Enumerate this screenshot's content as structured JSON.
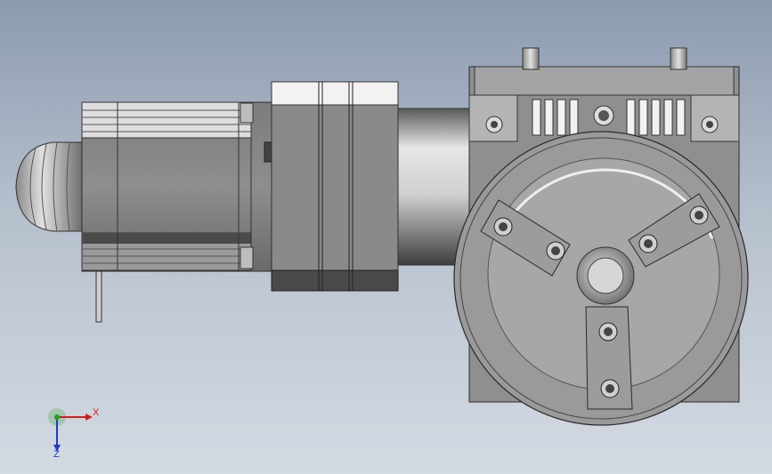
{
  "view": {
    "background_top": "#8c9bb0",
    "background_bottom": "#d4dae2"
  },
  "triad": {
    "x_label": "X",
    "z_label": "Z",
    "x_color": "#d21e1e",
    "y_color": "#1ea01e",
    "z_color": "#1e3cc8"
  },
  "chuck": {
    "jaw_count": 3
  }
}
